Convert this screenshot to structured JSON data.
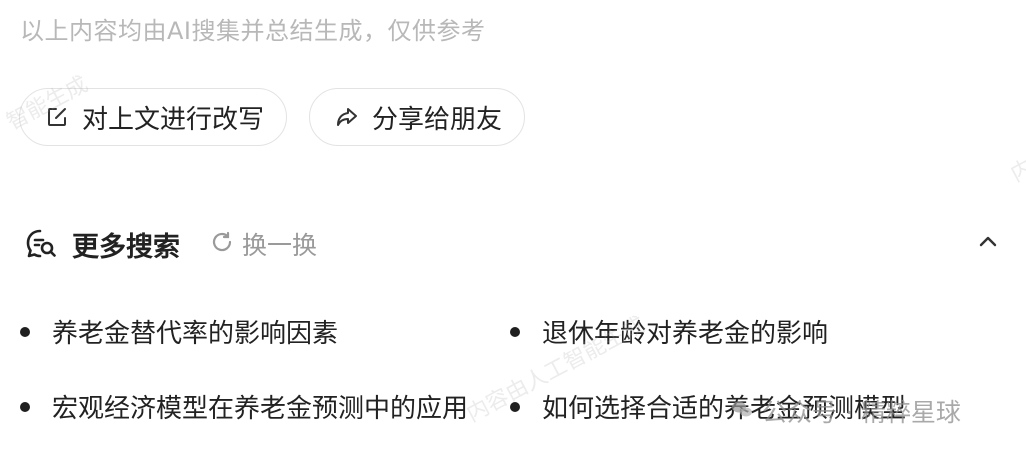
{
  "disclaimer": "以上内容均由AI搜集并总结生成，仅供参考",
  "actions": {
    "rewrite": "对上文进行改写",
    "share": "分享给朋友"
  },
  "more_search": {
    "title": "更多搜索",
    "refresh": "换一换"
  },
  "suggestions": [
    "养老金替代率的影响因素",
    "退休年龄对养老金的影响",
    "宏观经济模型在养老金预测中的应用",
    "如何选择合适的养老金预测模型"
  ],
  "watermark": {
    "top_left": "智能生成",
    "center": "内容由人工智能生成",
    "right_edge": "内"
  },
  "brand_overlay": "公众号 · 精粹星球",
  "colors": {
    "muted_text": "#b8b8b8",
    "primary_text": "#222222",
    "border": "#e3e3e3",
    "secondary_text": "#9a9a9a"
  }
}
